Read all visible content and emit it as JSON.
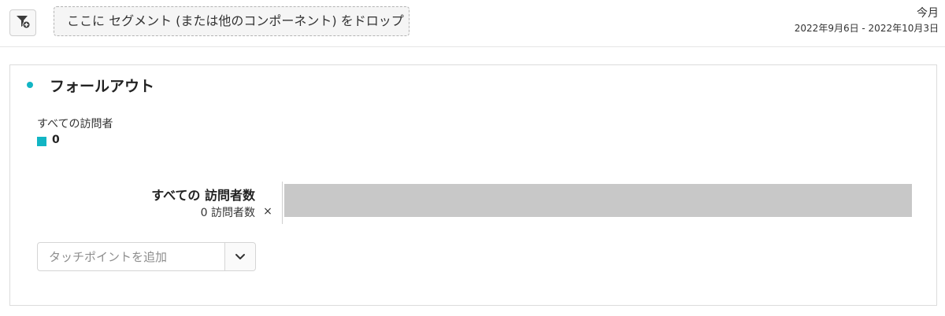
{
  "toolbar": {
    "filter_icon": "filter-add-icon",
    "dropzone_text": "ここに セグメント (または他のコンポーネント) をドロップ"
  },
  "date": {
    "title": "今月",
    "range": "2022年9月6日 - 2022年10月3日"
  },
  "panel": {
    "title": "フォールアウト",
    "accent_color": "#12b5c4",
    "legend": {
      "segment_label": "すべての訪問者",
      "value": "0"
    },
    "steps": [
      {
        "label": "すべての 訪問者数",
        "count": "0 訪問者数",
        "remove_symbol": "×",
        "fill_fraction": 1.0,
        "bar_color": "#c8c8c8"
      }
    ],
    "touchpoint": {
      "placeholder": "タッチポイントを追加",
      "dropdown_icon": "chevron-down-icon"
    }
  }
}
